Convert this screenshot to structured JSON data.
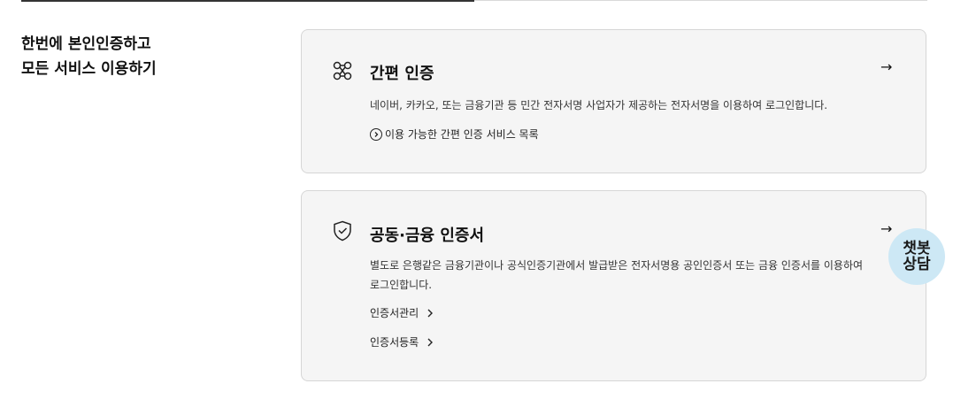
{
  "section": {
    "title_line1": "한번에 본인인증하고",
    "title_line2": "모든 서비스 이용하기"
  },
  "simple_auth": {
    "title": "간편 인증",
    "arrow": "→",
    "description": "네이버, 카카오, 또는 금융기관 등 민간 전자서명 사업자가 제공하는 전자서명을 이용하여 로그인합니다.",
    "link_label": "이용 가능한 간편 인증 서비스 목록",
    "icon": "network-icon"
  },
  "certificate": {
    "title": "공동·금융 인증서",
    "arrow": "→",
    "description": "별도로 은행같은 금융기관이나 공식인증기관에서 발급받은 전자서명용 공인인증서 또는 금융 인증서를 이용하여 로그인합니다.",
    "links": [
      {
        "label": "인증서관리"
      },
      {
        "label": "인증서등록"
      }
    ],
    "icon": "shield-check-icon"
  },
  "chatbot": {
    "line1": "챗봇",
    "line2": "상담"
  },
  "colors": {
    "card_bg": "#f5f5f5",
    "card_border": "#d6d6d6",
    "chatbot_bg": "#cde8f5"
  }
}
